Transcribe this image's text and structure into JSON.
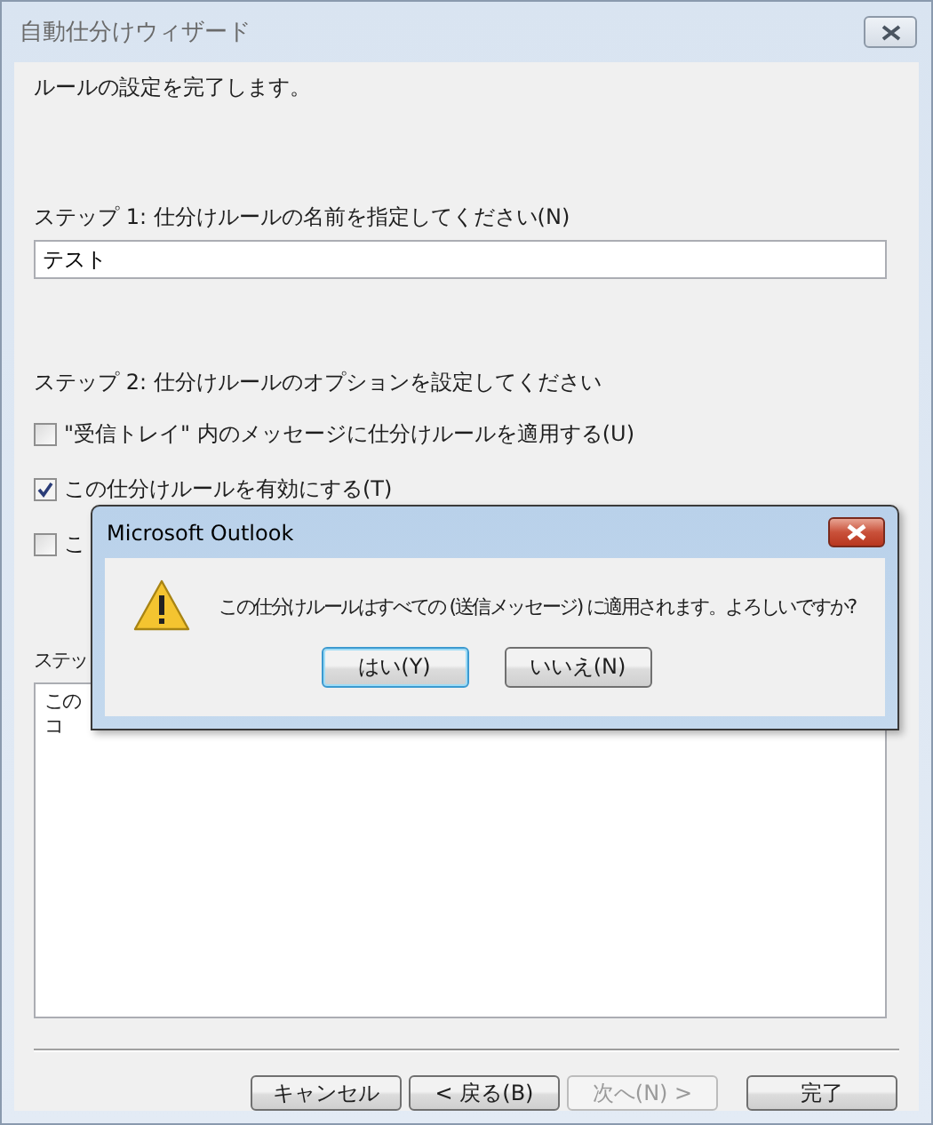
{
  "window": {
    "title": "自動仕分けウィザード"
  },
  "intro": "ルールの設定を完了します。",
  "step1": {
    "label": "ステップ 1: 仕分けルールの名前を指定してください(N)",
    "name_field": {
      "value": "テスト"
    }
  },
  "step2": {
    "label": "ステップ 2: 仕分けルールのオプションを設定してください",
    "options": [
      {
        "label": "\"受信トレイ\" 内のメッセージに仕分けルールを適用する(U)",
        "checked": false
      },
      {
        "label": "この仕分けルールを有効にする(T)",
        "checked": true
      },
      {
        "label": "こ",
        "checked": false
      }
    ]
  },
  "step3": {
    "label": "ステッ",
    "description": [
      "この",
      "コ"
    ]
  },
  "buttons": [
    {
      "label": "キャンセル",
      "disabled": false
    },
    {
      "label": "< 戻る(B)",
      "disabled": false
    },
    {
      "label": "次へ(N) >",
      "disabled": true
    },
    {
      "label": "完了",
      "disabled": false
    }
  ],
  "dialog": {
    "title": "Microsoft Outlook",
    "message": "この仕分けルールはすべての (送信メッセージ) に適用されます。よろしいですか?",
    "buttons": [
      {
        "label": "はい(Y)",
        "default": true
      },
      {
        "label": "いいえ(N)",
        "default": false
      }
    ]
  }
}
